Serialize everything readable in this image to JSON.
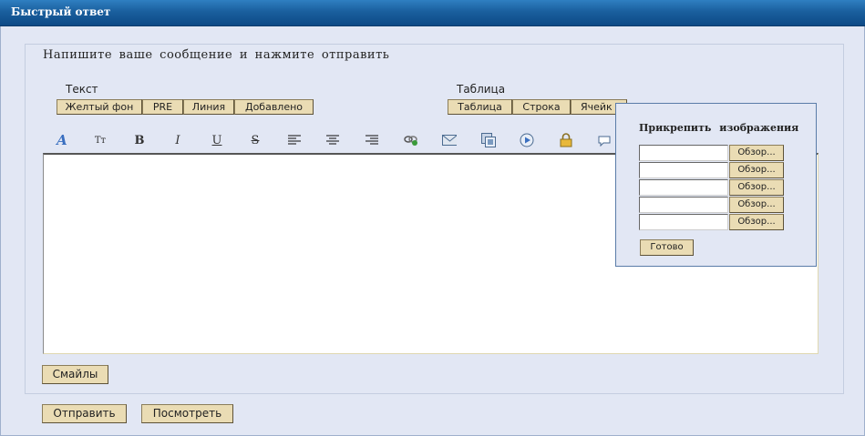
{
  "header": {
    "title": "Быстрый ответ"
  },
  "form": {
    "instruction": "Напишите ваше сообщение и нажмите отправить",
    "text_group": {
      "label": "Текст",
      "buttons": [
        "Желтый фон",
        "PRE",
        "Линия",
        "Добавлено"
      ]
    },
    "table_group": {
      "label": "Таблица",
      "buttons": [
        "Таблица",
        "Строка",
        "Ячейк"
      ]
    },
    "toolbar_icons": [
      "font-color-icon",
      "font-size-icon",
      "bold-icon",
      "italic-icon",
      "underline-icon",
      "strikethrough-icon",
      "align-left-icon",
      "align-center-icon",
      "align-right-icon",
      "link-icon",
      "email-icon",
      "image-icon",
      "media-icon",
      "lock-icon",
      "quote-icon"
    ],
    "toolbar_glyphs": {
      "font_color": "A",
      "font_size": "Tт",
      "bold": "B",
      "italic": "I",
      "underline": "U",
      "strike": "S"
    },
    "editor_value": "",
    "smileys_label": "Смайлы",
    "send_label": "Отправить",
    "preview_label": "Посмотреть"
  },
  "attach_popup": {
    "title": "Прикрепить изображения",
    "browse_label": "Обзор...",
    "done_label": "Готово",
    "inputs": [
      "",
      "",
      "",
      "",
      ""
    ]
  },
  "colors": {
    "title_bg": "#1a5f9e",
    "panel_bg": "#e2e7f4",
    "button_bg": "#eadcb4"
  }
}
